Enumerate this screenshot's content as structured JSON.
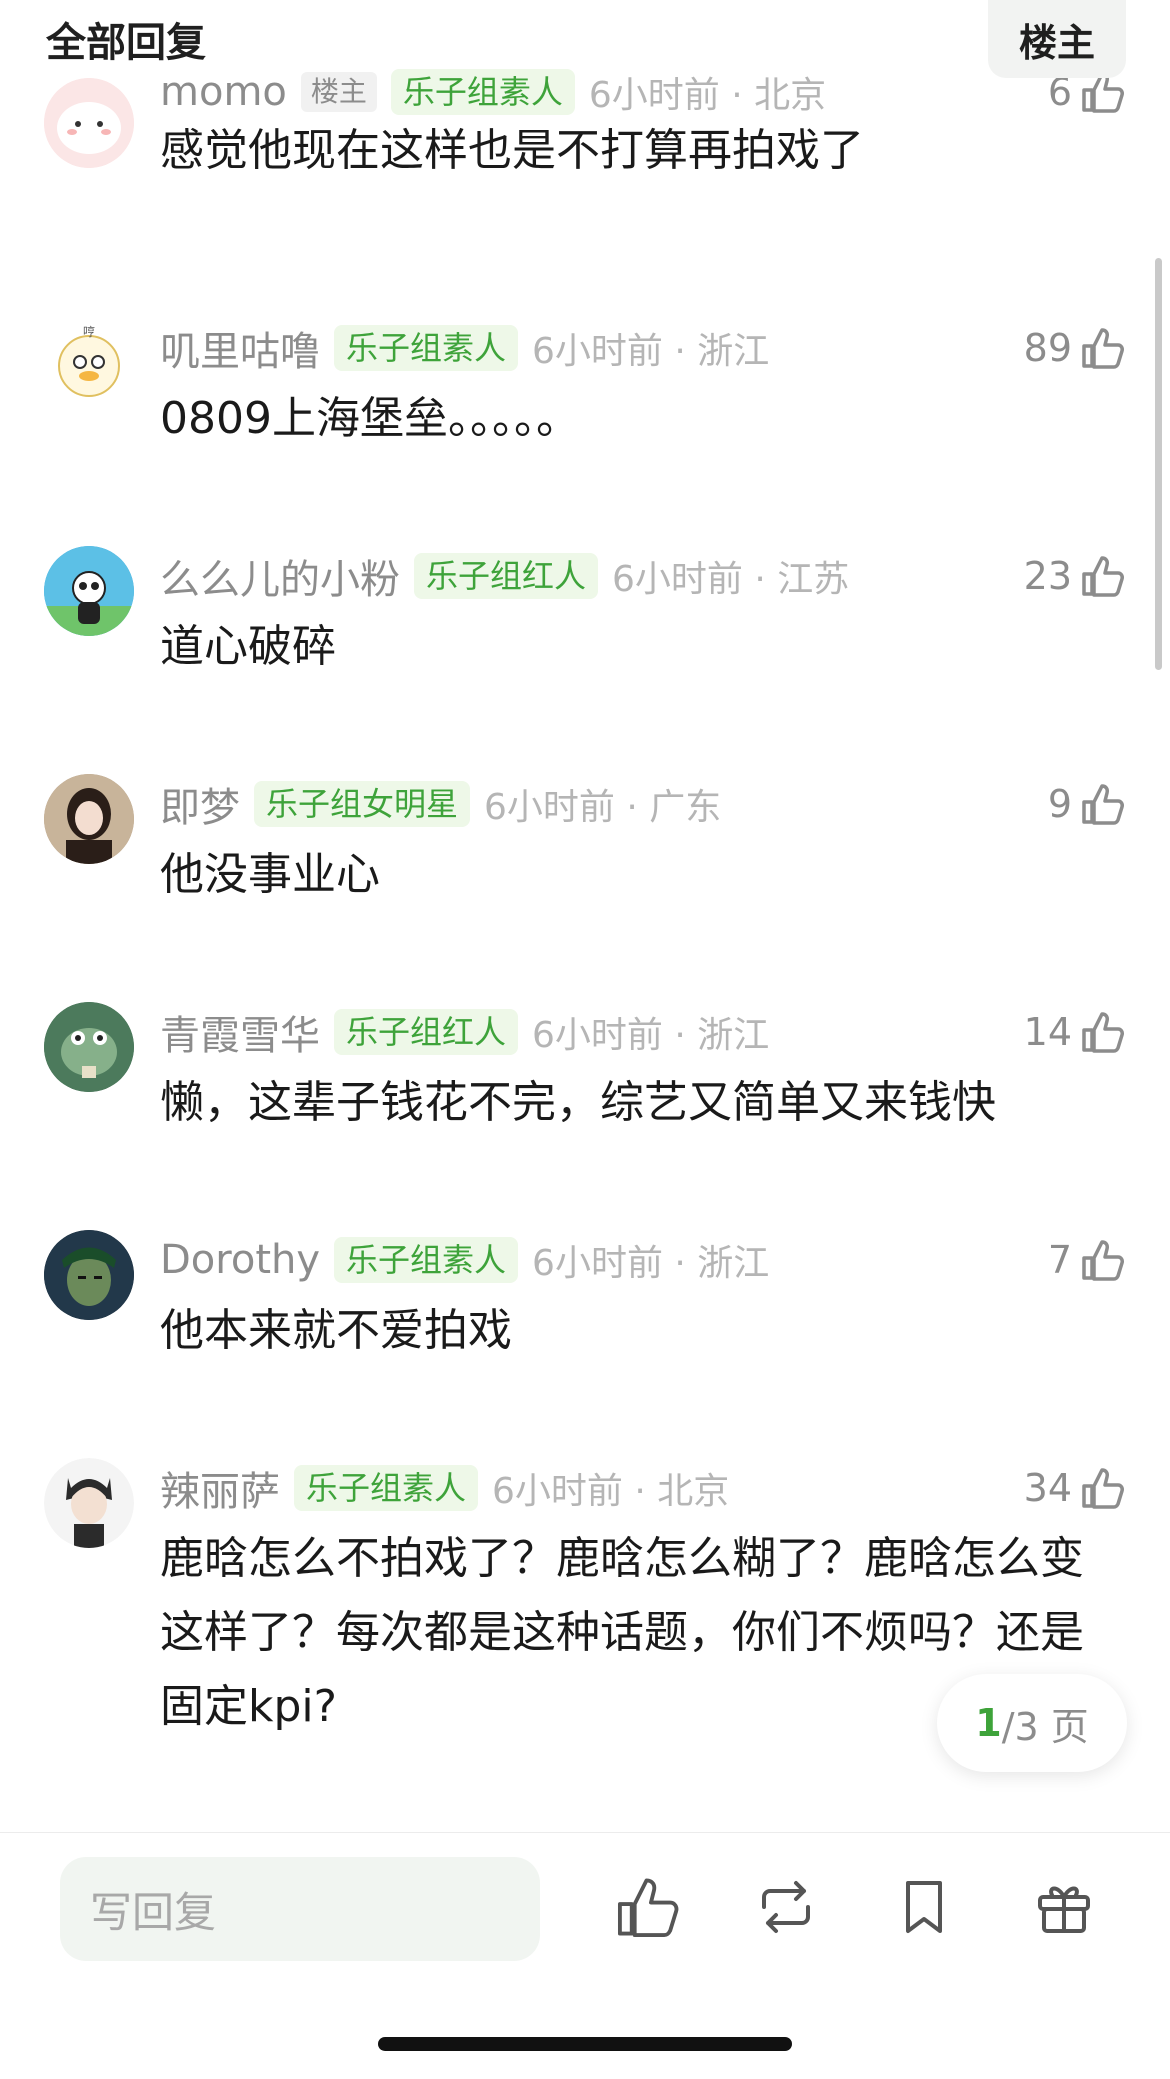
{
  "header": {
    "title": "全部回复",
    "op_button": "楼主"
  },
  "comments": [
    {
      "user": "momo",
      "op_badge": "楼主",
      "badge": "乐子组素人",
      "time": "6小时前 · 北京",
      "likes": "6",
      "text": "感觉他现在这样也是不打算再拍戏了"
    },
    {
      "user": "叽里咕噜",
      "badge": "乐子组素人",
      "time": "6小时前 · 浙江",
      "likes": "89",
      "text": "0809上海堡垒。。。。。"
    },
    {
      "user": "么么儿的小粉",
      "badge": "乐子组红人",
      "time": "6小时前 · 江苏",
      "likes": "23",
      "text": "道心破碎"
    },
    {
      "user": "即梦",
      "badge": "乐子组女明星",
      "time": "6小时前 · 广东",
      "likes": "9",
      "text": "他没事业心"
    },
    {
      "user": "青霞雪华",
      "badge": "乐子组红人",
      "time": "6小时前 · 浙江",
      "likes": "14",
      "text": "懒，这辈子钱花不完，综艺又简单又来钱快"
    },
    {
      "user": "Dorothy",
      "badge": "乐子组素人",
      "time": "6小时前 · 浙江",
      "likes": "7",
      "text": "他本来就不爱拍戏"
    },
    {
      "user": "辣丽萨",
      "badge": "乐子组素人",
      "time": "6小时前 · 北京",
      "likes": "34",
      "text": "鹿晗怎么不拍戏了？鹿晗怎么糊了？鹿晗怎么变这样了？每次都是这种话题，你们不烦吗？还是固定kpi?"
    }
  ],
  "pager": {
    "current": "1",
    "rest": "/3 页"
  },
  "bottom": {
    "reply_placeholder": "写回复"
  },
  "colors": {
    "accent": "#3ea33a",
    "badge_bg": "#eef8e8"
  },
  "icons": [
    "thumbs-up-icon",
    "repost-icon",
    "bookmark-icon",
    "gift-icon"
  ]
}
